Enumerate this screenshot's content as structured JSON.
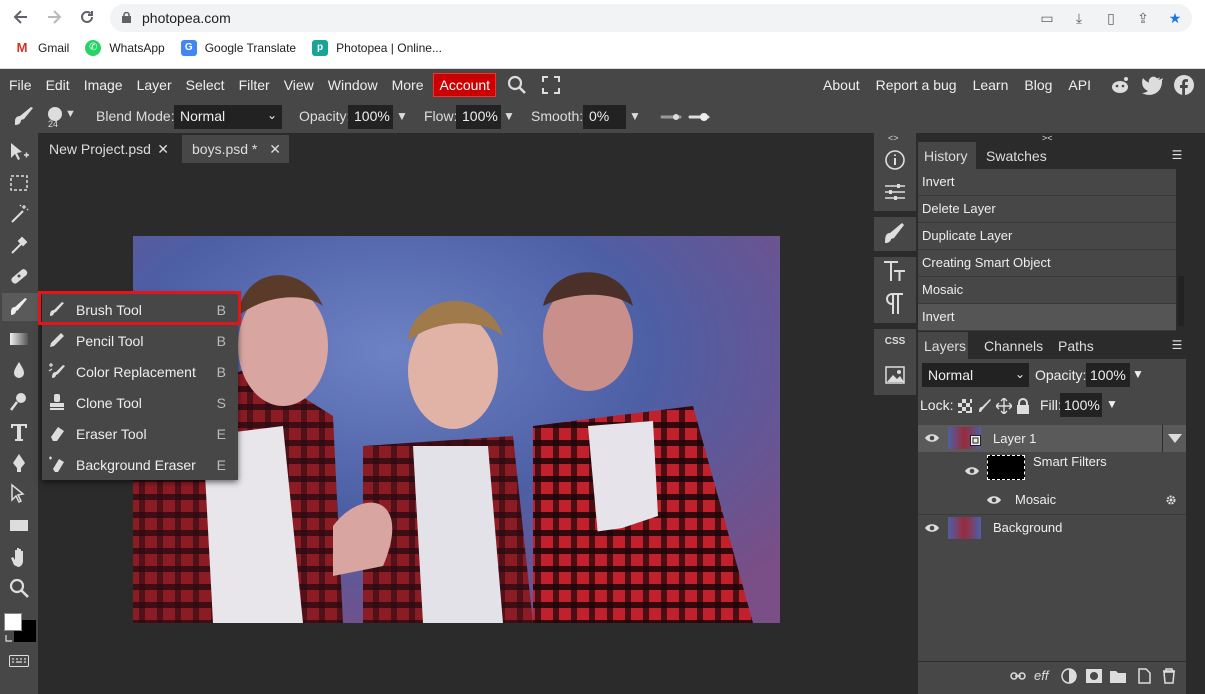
{
  "browser": {
    "url": "photopea.com",
    "bookmarks": [
      {
        "label": "Gmail",
        "icon": "gmail-icon"
      },
      {
        "label": "WhatsApp",
        "icon": "whatsapp-icon"
      },
      {
        "label": "Google Translate",
        "icon": "google-translate-icon"
      },
      {
        "label": "Photopea | Online...",
        "icon": "photopea-icon"
      }
    ]
  },
  "menubar": {
    "items": [
      "File",
      "Edit",
      "Image",
      "Layer",
      "Select",
      "Filter",
      "View",
      "Window",
      "More"
    ],
    "account": "Account",
    "right_links": [
      "About",
      "Report a bug",
      "Learn",
      "Blog",
      "API"
    ]
  },
  "options": {
    "brush_size": "24",
    "blend_label": "Blend Mode:",
    "blend_value": "Normal",
    "opacity_label": "Opacity:",
    "opacity_value": "100%",
    "flow_label": "Flow:",
    "flow_value": "100%",
    "smooth_label": "Smooth:",
    "smooth_value": "0%"
  },
  "tabs": [
    {
      "label": "New Project.psd",
      "close": "✕"
    },
    {
      "label": "boys.psd *",
      "close": "✕"
    }
  ],
  "flyout": {
    "items": [
      {
        "label": "Brush Tool",
        "key": "B"
      },
      {
        "label": "Pencil Tool",
        "key": "B"
      },
      {
        "label": "Color Replacement",
        "key": "B"
      },
      {
        "label": "Clone Tool",
        "key": "S"
      },
      {
        "label": "Eraser Tool",
        "key": "E"
      },
      {
        "label": "Background Eraser",
        "key": "E"
      }
    ]
  },
  "iconcol": {
    "css_label": "CSS"
  },
  "history_panel": {
    "tabs": [
      "History",
      "Swatches"
    ],
    "items": [
      "Invert",
      "Delete Layer",
      "Duplicate Layer",
      "Creating Smart Object",
      "Mosaic",
      "Invert"
    ]
  },
  "layers_panel": {
    "tabs": [
      "Layers",
      "Channels",
      "Paths"
    ],
    "blend_mode": "Normal",
    "opacity_label": "Opacity:",
    "opacity_value": "100%",
    "lock_label": "Lock:",
    "fill_label": "Fill:",
    "fill_value": "100%",
    "layers": {
      "layer1": "Layer 1",
      "smart_filters": "Smart Filters",
      "mosaic": "Mosaic",
      "background": "Background"
    },
    "footer_fx": "eff"
  },
  "colors": {
    "accent_red": "#e3151b",
    "account_red": "#cc0000",
    "panel_bg": "#474747",
    "workspace_bg": "#2b2b2b"
  }
}
